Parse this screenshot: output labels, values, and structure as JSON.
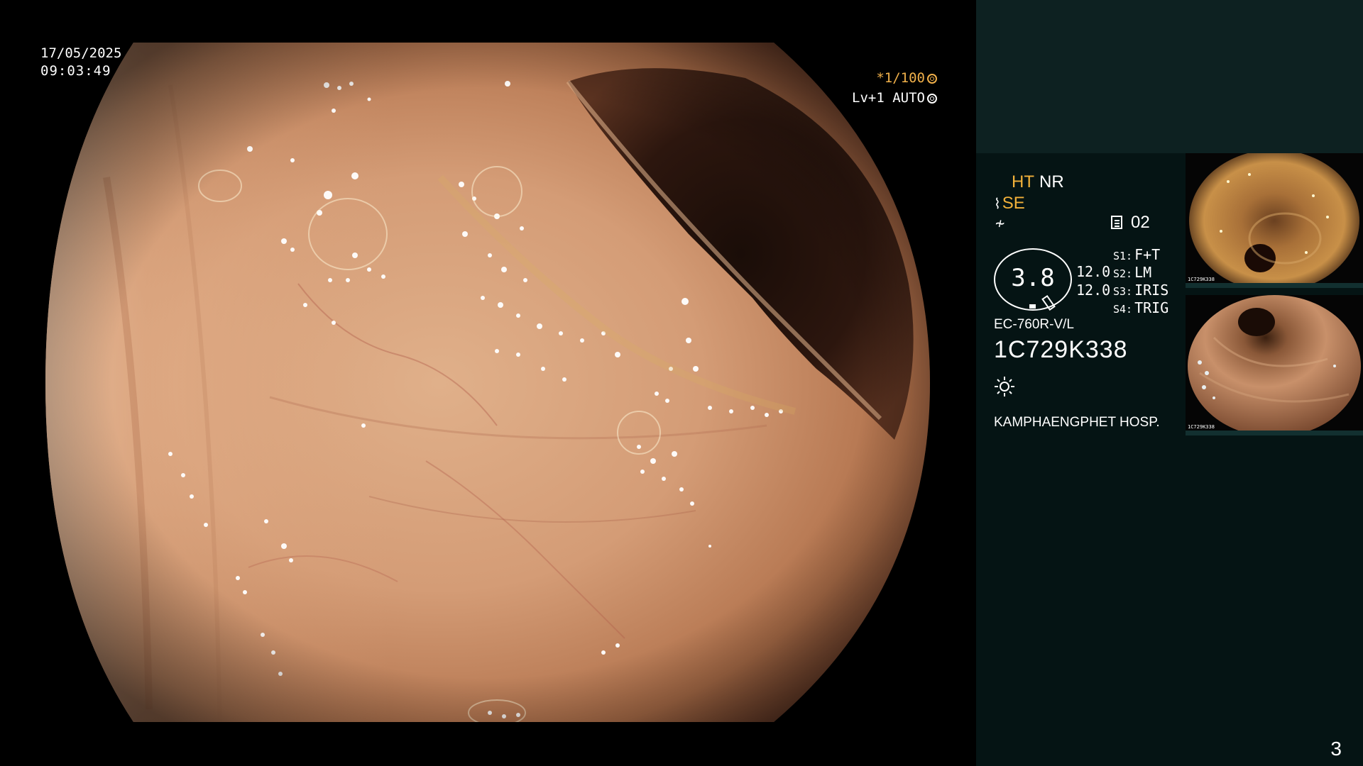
{
  "overlay": {
    "date": "17/05/2025",
    "time": "09:03:49",
    "shutter": "*1/100",
    "agc": "Lv+1 AUTO"
  },
  "settings": {
    "ht": "HT",
    "nr": "NR",
    "se": "SE",
    "memo_number": "02",
    "scope_value": "3.8",
    "value_1": "12.0",
    "value_2": "12.0",
    "switches": [
      {
        "key": "S1:",
        "value": "F+T"
      },
      {
        "key": "S2:",
        "value": "LM"
      },
      {
        "key": "S3:",
        "value": "IRIS"
      },
      {
        "key": "S4:",
        "value": "TRIG"
      }
    ]
  },
  "scope": {
    "model": "EC-760R-V/L",
    "serial": "1C729K338"
  },
  "hospital": "KAMPHAENGPHET HOSP.",
  "thumbnails": [
    {
      "label": "1C729K338"
    },
    {
      "label": "1C729K338"
    }
  ],
  "page_number": "3",
  "colors": {
    "accent_orange": "#f2b13a",
    "panel_top": "#0d2121",
    "panel_bottom": "#051414",
    "tissue": "#c98d67"
  },
  "icons": {
    "shutter": "aperture-icon",
    "agc": "iris-icon",
    "light": "sun-icon",
    "memo": "memo-icon"
  }
}
